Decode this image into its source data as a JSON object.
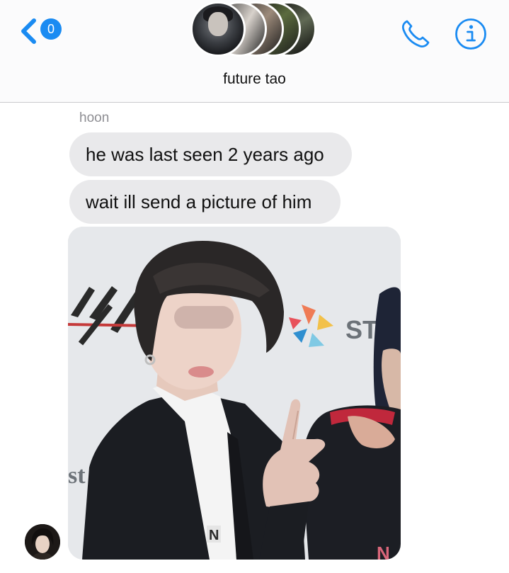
{
  "header": {
    "back_badge": "0",
    "conversation_title": "future tao",
    "accent_color": "#1a8bf2",
    "icons": [
      "chevron-left-icon",
      "phone-icon",
      "info-icon"
    ]
  },
  "messages": {
    "sender_name": "hoon",
    "items": [
      {
        "text": "he was last seen 2 years ago"
      },
      {
        "text": "wait ill send a picture of him"
      }
    ]
  },
  "photo": {
    "backdrop_text_1": "ST",
    "backdrop_text_2": "st",
    "jacket_letter": "N"
  }
}
